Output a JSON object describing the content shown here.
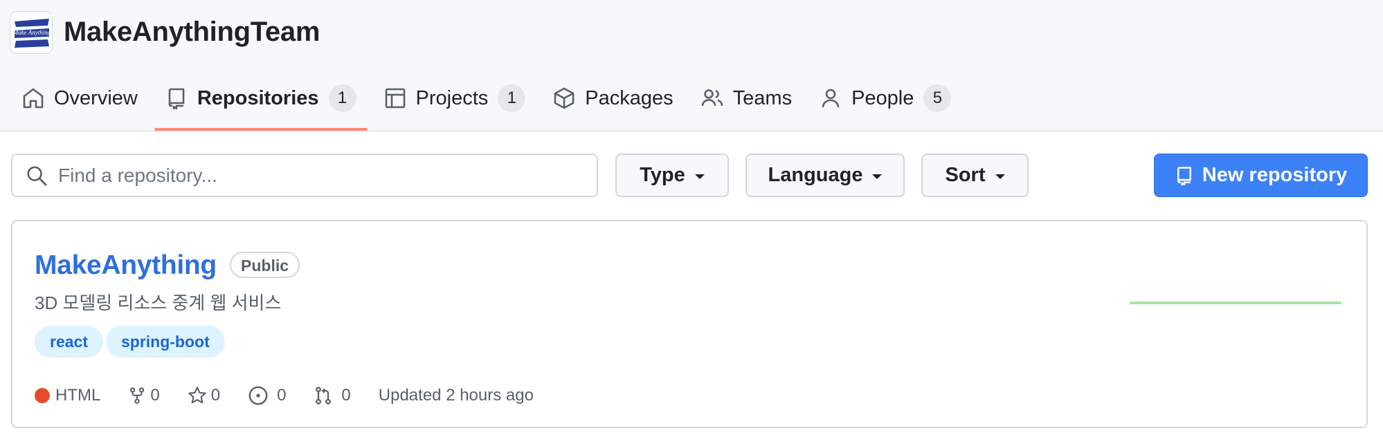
{
  "org": {
    "name": "MakeAnythingTeam",
    "avatar_text": "Make Anything"
  },
  "nav": {
    "tabs": [
      {
        "label": "Overview",
        "icon": "home-icon"
      },
      {
        "label": "Repositories",
        "icon": "repo-icon",
        "count": "1",
        "active": true
      },
      {
        "label": "Projects",
        "icon": "table-icon",
        "count": "1"
      },
      {
        "label": "Packages",
        "icon": "package-icon"
      },
      {
        "label": "Teams",
        "icon": "people-icon"
      },
      {
        "label": "People",
        "icon": "person-icon",
        "count": "5"
      }
    ]
  },
  "filters": {
    "search_placeholder": "Find a repository...",
    "type_label": "Type",
    "language_label": "Language",
    "sort_label": "Sort",
    "new_repo_label": "New repository"
  },
  "repo": {
    "name": "MakeAnything",
    "visibility": "Public",
    "description": "3D 모델링 리소스 중계 웹 서비스",
    "topics": [
      "react",
      "spring-boot"
    ],
    "language": "HTML",
    "language_color": "#e34c26",
    "forks": "0",
    "stars": "0",
    "issues": "0",
    "pull_requests": "0",
    "updated": "Updated 2 hours ago"
  },
  "colors": {
    "accent": "#3c82f6",
    "link": "#2f6fdd",
    "tab_underline": "#fd8c73",
    "sparkline": "#a7e3a7"
  }
}
